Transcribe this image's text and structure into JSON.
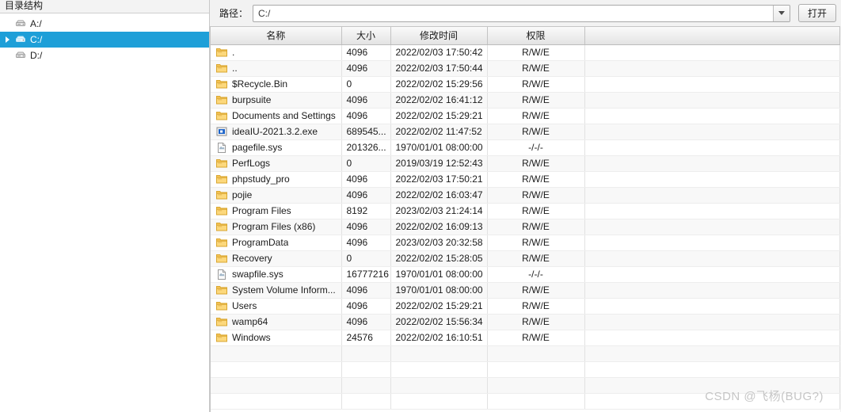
{
  "sidebar": {
    "header": "目录结构",
    "items": [
      {
        "label": "A:/",
        "icon": "drive-icon",
        "selected": false,
        "expandable": false
      },
      {
        "label": "C:/",
        "icon": "drive-icon",
        "selected": true,
        "expandable": true
      },
      {
        "label": "D:/",
        "icon": "drive-icon",
        "selected": false,
        "expandable": false
      }
    ],
    "selection_color": "#1e9fd8"
  },
  "toolbar": {
    "path_label": "路径：",
    "path_value": "C:/",
    "path_placeholder": "C:/",
    "dropdown_icon": "chevron-down-icon",
    "open_label": "打开"
  },
  "table": {
    "columns": [
      {
        "key": "name",
        "label": "名称"
      },
      {
        "key": "size",
        "label": "大小"
      },
      {
        "key": "mtime",
        "label": "修改时间"
      },
      {
        "key": "perm",
        "label": "权限"
      },
      {
        "key": "pad",
        "label": ""
      }
    ],
    "rows": [
      {
        "icon": "folder-icon",
        "name": ".",
        "size": "4096",
        "mtime": "2022/02/03 17:50:42",
        "perm": "R/W/E"
      },
      {
        "icon": "folder-icon",
        "name": "..",
        "size": "4096",
        "mtime": "2022/02/03 17:50:44",
        "perm": "R/W/E"
      },
      {
        "icon": "folder-icon",
        "name": "$Recycle.Bin",
        "size": "0",
        "mtime": "2022/02/02 15:29:56",
        "perm": "R/W/E"
      },
      {
        "icon": "folder-icon",
        "name": "burpsuite",
        "size": "4096",
        "mtime": "2022/02/02 16:41:12",
        "perm": "R/W/E"
      },
      {
        "icon": "folder-icon",
        "name": "Documents and Settings",
        "size": "4096",
        "mtime": "2022/02/02 15:29:21",
        "perm": "R/W/E"
      },
      {
        "icon": "exe-icon",
        "name": "ideaIU-2021.3.2.exe",
        "size": "689545...",
        "mtime": "2022/02/02 11:47:52",
        "perm": "R/W/E"
      },
      {
        "icon": "file-icon",
        "name": "pagefile.sys",
        "size": "201326...",
        "mtime": "1970/01/01 08:00:00",
        "perm": "-/-/-"
      },
      {
        "icon": "folder-icon",
        "name": "PerfLogs",
        "size": "0",
        "mtime": "2019/03/19 12:52:43",
        "perm": "R/W/E"
      },
      {
        "icon": "folder-icon",
        "name": "phpstudy_pro",
        "size": "4096",
        "mtime": "2022/02/03 17:50:21",
        "perm": "R/W/E"
      },
      {
        "icon": "folder-icon",
        "name": "pojie",
        "size": "4096",
        "mtime": "2022/02/02 16:03:47",
        "perm": "R/W/E"
      },
      {
        "icon": "folder-icon",
        "name": "Program Files",
        "size": "8192",
        "mtime": "2023/02/03 21:24:14",
        "perm": "R/W/E"
      },
      {
        "icon": "folder-icon",
        "name": "Program Files (x86)",
        "size": "4096",
        "mtime": "2022/02/02 16:09:13",
        "perm": "R/W/E"
      },
      {
        "icon": "folder-icon",
        "name": "ProgramData",
        "size": "4096",
        "mtime": "2023/02/03 20:32:58",
        "perm": "R/W/E"
      },
      {
        "icon": "folder-icon",
        "name": "Recovery",
        "size": "0",
        "mtime": "2022/02/02 15:28:05",
        "perm": "R/W/E"
      },
      {
        "icon": "file-icon",
        "name": "swapfile.sys",
        "size": "16777216",
        "mtime": "1970/01/01 08:00:00",
        "perm": "-/-/-"
      },
      {
        "icon": "folder-icon",
        "name": "System Volume Inform...",
        "size": "4096",
        "mtime": "1970/01/01 08:00:00",
        "perm": "R/W/E"
      },
      {
        "icon": "folder-icon",
        "name": "Users",
        "size": "4096",
        "mtime": "2022/02/02 15:29:21",
        "perm": "R/W/E"
      },
      {
        "icon": "folder-icon",
        "name": "wamp64",
        "size": "4096",
        "mtime": "2022/02/02 15:56:34",
        "perm": "R/W/E"
      },
      {
        "icon": "folder-icon",
        "name": "Windows",
        "size": "24576",
        "mtime": "2022/02/02 16:10:51",
        "perm": "R/W/E"
      },
      {
        "icon": "",
        "name": "",
        "size": "",
        "mtime": "",
        "perm": ""
      },
      {
        "icon": "",
        "name": "",
        "size": "",
        "mtime": "",
        "perm": ""
      },
      {
        "icon": "",
        "name": "",
        "size": "",
        "mtime": "",
        "perm": ""
      },
      {
        "icon": "",
        "name": "",
        "size": "",
        "mtime": "",
        "perm": ""
      }
    ]
  },
  "watermark": {
    "text": "CSDN @飞杨(BUG?)"
  }
}
